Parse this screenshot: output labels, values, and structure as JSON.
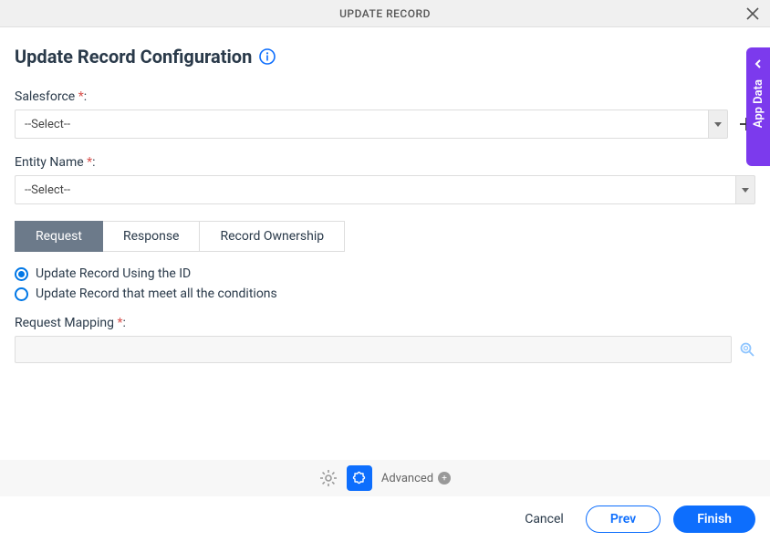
{
  "titlebar": {
    "title": "UPDATE RECORD"
  },
  "page": {
    "heading": "Update Record Configuration"
  },
  "fields": {
    "salesforce": {
      "label": "Salesforce",
      "value": "--Select--"
    },
    "entity": {
      "label": "Entity Name",
      "value": "--Select--"
    },
    "requestMapping": {
      "label": "Request Mapping"
    }
  },
  "tabs": {
    "request": {
      "label": "Request"
    },
    "response": {
      "label": "Response"
    },
    "ownership": {
      "label": "Record Ownership"
    }
  },
  "radios": {
    "byId": {
      "label": "Update Record Using the ID"
    },
    "byCondition": {
      "label": "Update Record that meet all the conditions"
    }
  },
  "advanced": {
    "label": "Advanced"
  },
  "footer": {
    "cancel": "Cancel",
    "prev": "Prev",
    "finish": "Finish"
  },
  "sideDrawer": {
    "label": "App Data"
  },
  "colors": {
    "accent": "#0d6efd",
    "sidebar": "#7c3aed",
    "tabActive": "#6c7a8a"
  }
}
